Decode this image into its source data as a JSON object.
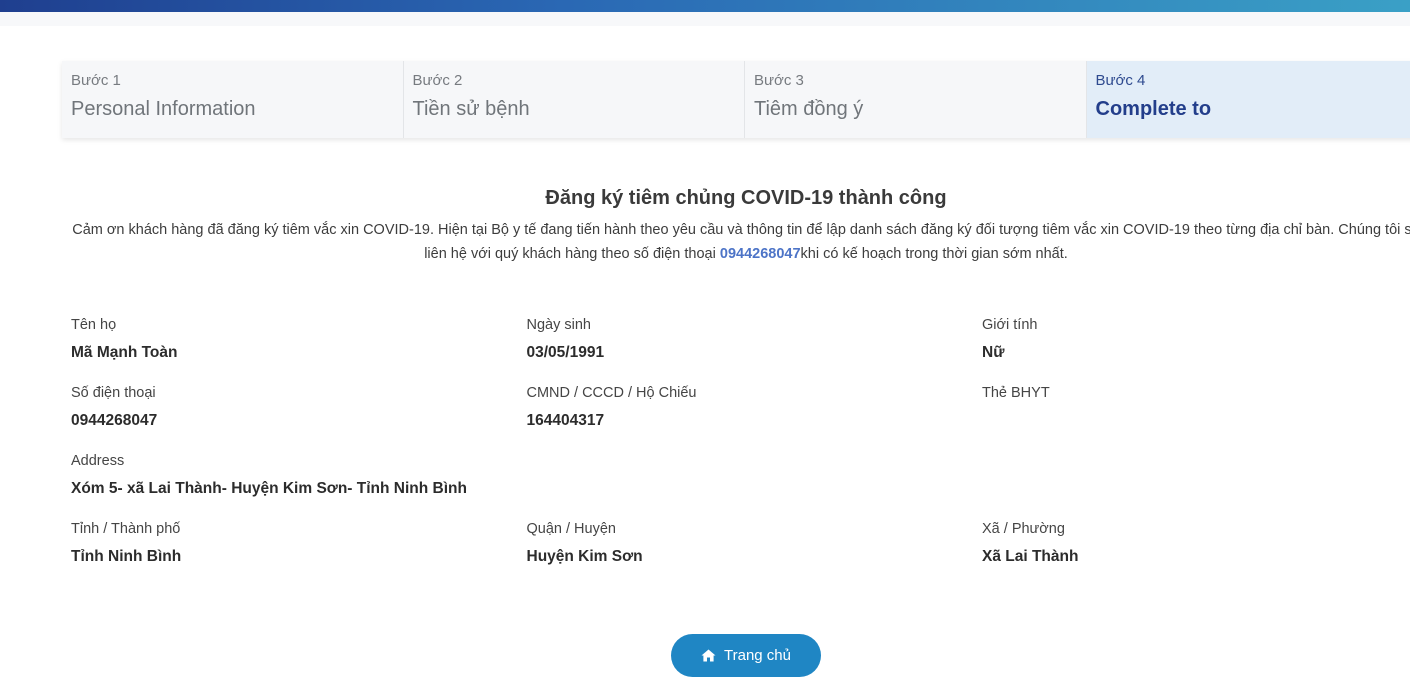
{
  "steps": [
    {
      "number": "Bước 1",
      "title": "Personal Information"
    },
    {
      "number": "Bước 2",
      "title": "Tiền sử bệnh"
    },
    {
      "number": "Bước 3",
      "title": "Tiêm đồng ý"
    },
    {
      "number": "Bước 4",
      "title": "Complete to"
    }
  ],
  "active_step": 4,
  "success": {
    "title": "Đăng ký tiêm chủng COVID-19 thành công",
    "message_before": "Cảm ơn khách hàng đã đăng ký tiêm vắc xin COVID-19. Hiện tại Bộ y tế đang tiến hành theo yêu cầu và thông tin để lập danh sách đăng ký đối tượng tiêm vắc xin COVID-19 theo từng địa chỉ bàn. Chúng tôi sẽ liên hệ với quý khách hàng theo số điện thoại ",
    "phone": "0944268047",
    "message_after": "khi có kế hoạch trong thời gian sớm nhất."
  },
  "info": {
    "full_name": {
      "label": "Tên họ",
      "value": "Mã Mạnh Toàn"
    },
    "dob": {
      "label": "Ngày sinh",
      "value": "03/05/1991"
    },
    "gender": {
      "label": "Giới tính",
      "value": "Nữ"
    },
    "phone": {
      "label": "Số điện thoại",
      "value": "0944268047"
    },
    "id_number": {
      "label": "CMND / CCCD / Hộ Chiếu",
      "value": "164404317"
    },
    "insurance": {
      "label": "Thẻ BHYT",
      "value": ""
    },
    "address": {
      "label": "Address",
      "value": "Xóm 5- xã Lai Thành- Huyện Kim Sơn- Tỉnh Ninh Bình"
    },
    "province": {
      "label": "Tỉnh / Thành phố",
      "value": "Tỉnh Ninh Bình"
    },
    "district": {
      "label": "Quận / Huyện",
      "value": "Huyện Kim Sơn"
    },
    "ward": {
      "label": "Xã / Phường",
      "value": "Xã Lai Thành"
    }
  },
  "home_button": {
    "label": "Trang chủ",
    "icon": "home-icon"
  },
  "colors": {
    "accent": "#1f86c4",
    "active_step_text": "#233e8b",
    "active_step_bg": "#e2edf8",
    "phone_highlight": "#4d74c7"
  }
}
